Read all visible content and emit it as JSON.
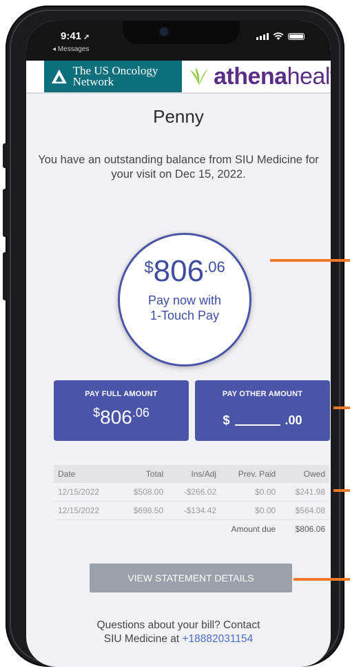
{
  "status_bar": {
    "time": "9:41",
    "back_label": "◂ Messages"
  },
  "logos": {
    "us_oncology": "The US Oncology Network",
    "athena_bold": "athena",
    "athena_light": "health"
  },
  "patient_name": "Penny",
  "balance_message": "You have an outstanding balance from SIU Medicine for your visit on Dec 15, 2022.",
  "one_touch": {
    "currency": "$",
    "dollars": "806",
    "cents": ".06",
    "label_line1": "Pay now with",
    "label_line2": "1-Touch Pay"
  },
  "pay_full": {
    "label": "PAY FULL AMOUNT",
    "currency": "$",
    "dollars": "806",
    "cents": ".06"
  },
  "pay_other": {
    "label": "PAY OTHER AMOUNT",
    "currency": "$",
    "cents": ".00"
  },
  "table": {
    "headers": [
      "Date",
      "Total",
      "Ins/Adj",
      "Prev. Paid",
      "Owed"
    ],
    "rows": [
      [
        "12/15/2022",
        "$508.00",
        "-$266.02",
        "$0.00",
        "$241.98"
      ],
      [
        "12/15/2022",
        "$698.50",
        "-$134.42",
        "$0.00",
        "$564.08"
      ]
    ],
    "amount_due_label": "Amount due",
    "amount_due_value": "$806.06"
  },
  "statement_button": "VIEW STATEMENT DETAILS",
  "questions": {
    "line1": "Questions about your bill? Contact",
    "line2_prefix": "SIU Medicine  at ",
    "phone": "+18882031154"
  },
  "colors": {
    "accent_blue": "#4a55a8",
    "callout_orange": "#f07a2a",
    "us_oncology_teal": "#0d6f7b",
    "athena_purple": "#5a2d86",
    "athena_green": "#8cc63f"
  }
}
